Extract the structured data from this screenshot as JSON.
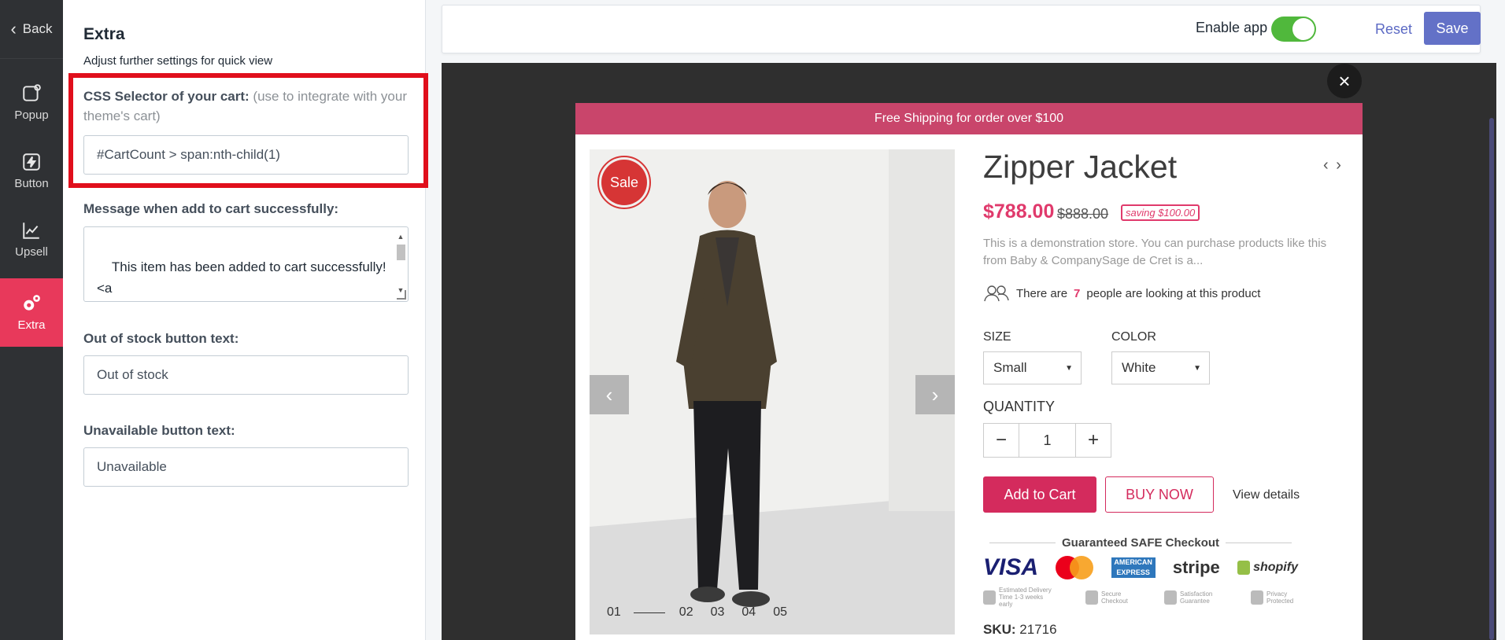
{
  "nav": {
    "back_label": "Back",
    "items": [
      {
        "label": "Popup",
        "icon": "popup-icon"
      },
      {
        "label": "Button",
        "icon": "lightning-icon"
      },
      {
        "label": "Upsell",
        "icon": "chart-icon"
      },
      {
        "label": "Extra",
        "icon": "gears-icon",
        "active": true
      }
    ],
    "active_color": "#e8395b"
  },
  "panel": {
    "title": "Extra",
    "subtitle": "Adjust further settings for quick view",
    "css_selector": {
      "label": "CSS Selector of your cart:",
      "hint": "(use to integrate with your theme's cart)",
      "value": "#CartCount > span:nth-child(1)"
    },
    "message": {
      "label": "Message when add to cart successfully:",
      "value": "This item has been added to cart successfully!\n<a\n    style=\"text-decoration:underline;\"\nhref=\"/cart\">View cart</a>"
    },
    "out_of_stock": {
      "label": "Out of stock button text:",
      "value": "Out of stock"
    },
    "unavailable": {
      "label": "Unavailable button text:",
      "value": "Unavailable"
    }
  },
  "topbar": {
    "enable_label": "Enable app",
    "enabled": true,
    "reset_label": "Reset",
    "save_label": "Save",
    "accent": "#6371c7"
  },
  "preview": {
    "close_label": "×",
    "shipping_banner": "Free Shipping for order over $100",
    "sale_badge": "Sale",
    "gallery_pages": [
      "01",
      "02",
      "03",
      "04",
      "05"
    ],
    "product": {
      "title": "Zipper Jacket",
      "nav_arrows": "‹ ›",
      "price": "$788.00",
      "compare_price": "$888.00",
      "saving": "saving $100.00",
      "description": "This is a demonstration store. You can purchase products like this from Baby & CompanySage de Cret is a...",
      "looking_prefix": "There are",
      "looking_count": "7",
      "looking_suffix": "people are looking at this product",
      "size_label": "SIZE",
      "size_value": "Small",
      "color_label": "COLOR",
      "color_value": "White",
      "quantity_label": "QUANTITY",
      "quantity_value": "1",
      "add_to_cart": "Add to Cart",
      "buy_now": "BUY NOW",
      "view_details": "View details",
      "safe_checkout": "Guaranteed SAFE Checkout",
      "payment_logos": {
        "visa": "VISA",
        "mastercard": "MasterCard",
        "amex": "AMERICAN EXPRESS",
        "stripe": "stripe",
        "shopify": "shopify"
      },
      "trust_badges": [
        "Estimated Delivery Time 1-3 weeks early",
        "Secure Checkout",
        "Satisfaction Guarantee",
        "Privacy Protected"
      ],
      "sku_label": "SKU:",
      "sku_value": "21716"
    },
    "brand_color": "#d42b5d"
  }
}
